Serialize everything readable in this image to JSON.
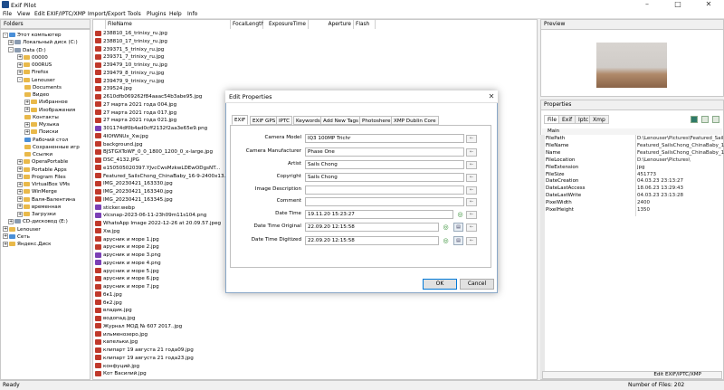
{
  "app": {
    "title": "Exif Pilot"
  },
  "menu": [
    "File",
    "View",
    "Edit EXIF/IPTC/XMP",
    "Import/Export",
    "Tools",
    "Plugins",
    "Help",
    "Info"
  ],
  "folders": {
    "header": "Folders",
    "items": [
      {
        "label": "Этот компьютер",
        "expander": "-",
        "icon": "blue"
      },
      {
        "label": "Локальный диск (C:)",
        "expander": "+",
        "icon": "drv"
      },
      {
        "label": "Data (D:)",
        "expander": "-",
        "icon": "drv"
      },
      {
        "label": "00000",
        "expander": "+",
        "icon": "folder"
      },
      {
        "label": "000RUS",
        "expander": "+",
        "icon": "folder"
      },
      {
        "label": "Firefox",
        "expander": "+",
        "icon": "folder"
      },
      {
        "label": "Lenouser",
        "expander": "-",
        "icon": "folder"
      },
      {
        "label": "Documents",
        "expander": "",
        "icon": "folder"
      },
      {
        "label": "Видео",
        "expander": "",
        "icon": "folder"
      },
      {
        "label": "Избранное",
        "expander": "+",
        "icon": "folder"
      },
      {
        "label": "Изображения",
        "expander": "+",
        "icon": "folder"
      },
      {
        "label": "Контакты",
        "expander": "",
        "icon": "folder"
      },
      {
        "label": "Музыка",
        "expander": "+",
        "icon": "folder"
      },
      {
        "label": "Поиски",
        "expander": "+",
        "icon": "folder"
      },
      {
        "label": "Рабочий стол",
        "expander": "",
        "icon": "blue"
      },
      {
        "label": "Сохраненные игр",
        "expander": "",
        "icon": "folder"
      },
      {
        "label": "Ссылки",
        "expander": "",
        "icon": "folder"
      },
      {
        "label": "OperaPortable",
        "expander": "+",
        "icon": "folder"
      },
      {
        "label": "Portable Apps",
        "expander": "+",
        "icon": "folder"
      },
      {
        "label": "Program Files",
        "expander": "+",
        "icon": "folder"
      },
      {
        "label": "VirtualBox VMs",
        "expander": "+",
        "icon": "folder"
      },
      {
        "label": "WinMerge",
        "expander": "+",
        "icon": "folder"
      },
      {
        "label": "Валя-Валентина",
        "expander": "+",
        "icon": "folder"
      },
      {
        "label": "временная",
        "expander": "+",
        "icon": "folder"
      },
      {
        "label": "Загрузки",
        "expander": "+",
        "icon": "folder"
      },
      {
        "label": "CD-дисковод (E:)",
        "expander": "+",
        "icon": "drv"
      },
      {
        "label": "Lenouser",
        "expander": "+",
        "icon": "folder"
      },
      {
        "label": "Сеть",
        "expander": "+",
        "icon": "blue"
      },
      {
        "label": "Яндекс.Диск",
        "expander": "+",
        "icon": "folder"
      }
    ]
  },
  "files": {
    "columns": [
      "FileName",
      "FocalLength",
      "ExposureTime",
      "Aperture",
      "Flash"
    ],
    "rows": [
      "238810_16_trinixy_ru.jpg",
      "238810_17_trinixy_ru.jpg",
      "239371_5_trinixy_ru.jpg",
      "239371_7_trinixy_ru.jpg",
      "239479_10_trinixy_ru.jpg",
      "239479_8_trinixy_ru.jpg",
      "239479_9_trinixy_ru.jpg",
      "239524.jpg",
      "2610dfb069262f84aaac54b3abe95.jpg",
      "27 марта 2021 года 004.jpg",
      "27 марта 2021 года 017.jpg",
      "27 марта 2021 года 021.jpg",
      "301174df0b4ad0cff2132f2aa3e65e9.png",
      "4IOfWNUx_Xw.jpg",
      "background.jpg",
      "BJSTGXToWF_0_0_1800_1200_0_x-large.jpg",
      "DSC_4132.JPG",
      "e150505020397.YJvcCwsMzkwLDEwODgsNT...",
      "Featured_SailsChong_ChinaBaby_16-9-2400x13...",
      "IMG_20230421_163330.jpg",
      "IMG_20230421_163340.jpg",
      "IMG_20230421_163345.jpg",
      "sticker.webp",
      "vlcsnap-2023-06-11-23h09m11s104.png",
      "WhatsApp Image 2022-12-26 at 20.09.57.jpeg",
      "Xw.jpg",
      "арусник и море 1.jpg",
      "арусник и море 2.jpg",
      "арусник и море 3.png",
      "арусник и море 4.png",
      "арусник и море 5.jpg",
      "арусник и море 6.jpg",
      "арусник и море 7.jpg",
      "бк1.jpg",
      "бк2.jpg",
      "владик.jpg",
      "водопад.jpg",
      "Журнал МОД № 607 2017..jpg",
      "ильменозеро.jpg",
      "капельки.jpg",
      "клипарт 19 августа 21 года09.jpg",
      "клипарт 19 августа 21 года23.jpg",
      "конфуций.jpg",
      "Кот Василий.jpg"
    ]
  },
  "preview": {
    "header": "Preview"
  },
  "properties": {
    "header": "Properties",
    "tabs": [
      "File",
      "Exif",
      "Iptc",
      "Xmp"
    ],
    "group": "Main",
    "rows": [
      {
        "k": "FilePath",
        "v": "D:\\Lenouser\\Pictures\\Featured_Sail..."
      },
      {
        "k": "FileName",
        "v": "Featured_SailsChong_ChinaBaby_1..."
      },
      {
        "k": "Name",
        "v": "Featured_SailsChong_ChinaBaby_1..."
      },
      {
        "k": "FileLocation",
        "v": "D:\\Lenouser\\Pictures\\"
      },
      {
        "k": "FileExtension",
        "v": "jpg"
      },
      {
        "k": "FileSize",
        "v": "451773"
      },
      {
        "k": "DateCreation",
        "v": "04.03.23 23:13:27"
      },
      {
        "k": "DateLastAccess",
        "v": "18.06.23 13:29:43"
      },
      {
        "k": "DateLastWrite",
        "v": "04.03.23 23:13:28"
      },
      {
        "k": "PixelWidth",
        "v": "2400"
      },
      {
        "k": "PixelHeight",
        "v": "1350"
      }
    ],
    "edit_button": "Edit EXIF/IPTC/XMP"
  },
  "dialog": {
    "title": "Edit Properties",
    "tabs": [
      "EXIF",
      "EXIF GPS",
      "IPTC",
      "Keywords",
      "Add New Tags",
      "Photoshere",
      "XMP Dublin Core"
    ],
    "fields": [
      {
        "label": "Camera Model",
        "value": "IQ3 100MP Trichr"
      },
      {
        "label": "Camera Manufacturer",
        "value": "Phase One"
      },
      {
        "label": "Artist",
        "value": "Sails Chong"
      },
      {
        "label": "Copyright",
        "value": "Sails Chong"
      },
      {
        "label": "Image Description",
        "value": ""
      },
      {
        "label": "Comment",
        "value": ""
      },
      {
        "label": "Date Time",
        "value": "19.11.20 15:23:27"
      },
      {
        "label": "Date Time Original",
        "value": "22.09.20 12:15:58"
      },
      {
        "label": "Date Time Digitized",
        "value": "22.09.20 12:15:58"
      }
    ],
    "ok": "OK",
    "cancel": "Cancel"
  },
  "status": {
    "left": "Ready",
    "right": "Number of Files: 202"
  }
}
